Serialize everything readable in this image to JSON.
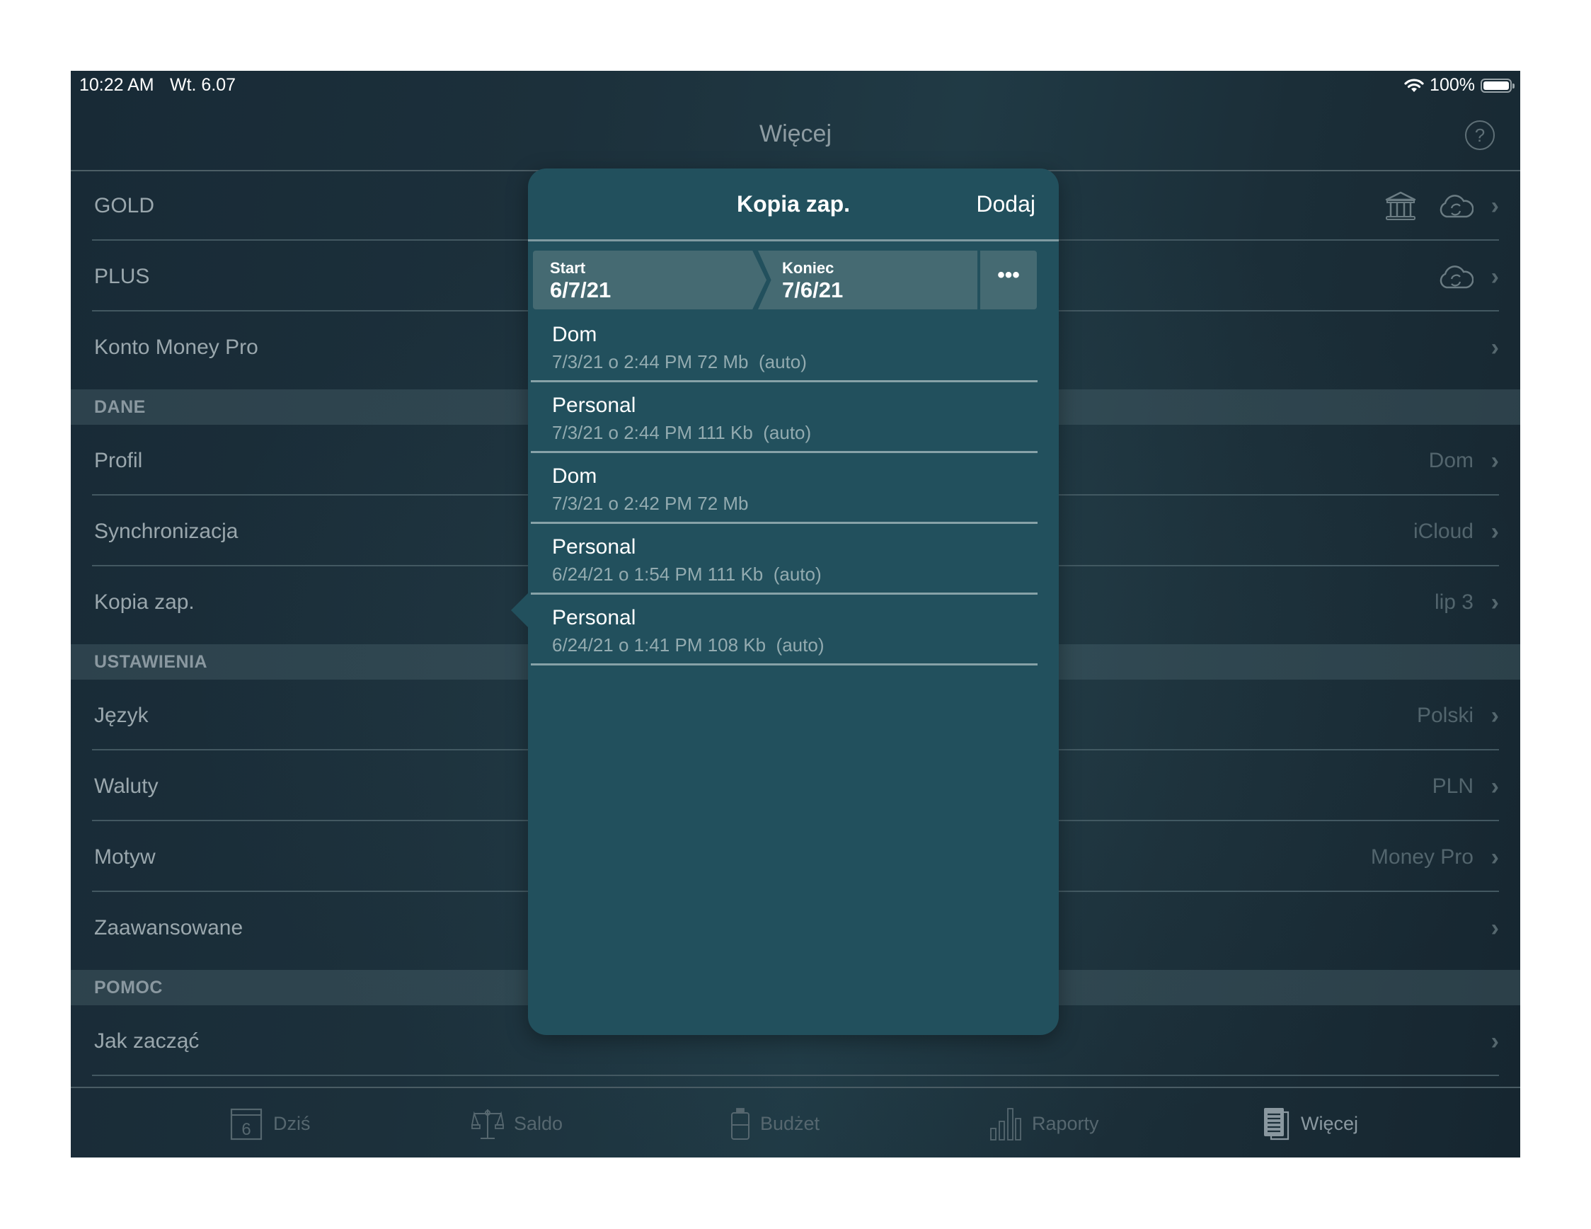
{
  "status_bar": {
    "time": "10:22 AM",
    "date": "Wt. 6.07",
    "battery": "100%",
    "battery_level": 1.0
  },
  "nav": {
    "title": "Więcej",
    "help_label": "?"
  },
  "list": {
    "rows_top": [
      {
        "label": "GOLD"
      },
      {
        "label": "PLUS"
      },
      {
        "label": "Konto Money Pro"
      }
    ],
    "sections": [
      {
        "title": "DANE",
        "rows": [
          {
            "label": "Profil",
            "value": "Dom"
          },
          {
            "label": "Synchronizacja",
            "value": "iCloud"
          },
          {
            "label": "Kopia zap.",
            "value": "lip 3"
          }
        ]
      },
      {
        "title": "USTAWIENIA",
        "rows": [
          {
            "label": "Język",
            "value": "Polski"
          },
          {
            "label": "Waluty",
            "value": "PLN"
          },
          {
            "label": "Motyw",
            "value": "Money Pro"
          },
          {
            "label": "Zaawansowane",
            "value": ""
          }
        ]
      },
      {
        "title": "POMOC",
        "rows": [
          {
            "label": "Jak zacząć",
            "value": ""
          }
        ]
      }
    ],
    "chevron": "›"
  },
  "popup": {
    "title": "Kopia zap.",
    "add_label": "Dodaj",
    "start_label": "Start",
    "start_value": "6/7/21",
    "end_label": "Koniec",
    "end_value": "7/6/21",
    "more_label": "•••",
    "items": [
      {
        "name": "Dom",
        "meta": "7/3/21 o 2:44 PM 72 Mb  (auto)"
      },
      {
        "name": "Personal",
        "meta": "7/3/21 o 2:44 PM 111 Kb  (auto)"
      },
      {
        "name": "Dom",
        "meta": "7/3/21 o 2:42 PM 72 Mb"
      },
      {
        "name": "Personal",
        "meta": "6/24/21 o 1:54 PM 111 Kb  (auto)"
      },
      {
        "name": "Personal",
        "meta": "6/24/21 o 1:41 PM 108 Kb  (auto)"
      }
    ]
  },
  "tabbar": {
    "tabs": [
      {
        "label": "Dziś",
        "icon": "calendar-icon",
        "badge": "6"
      },
      {
        "label": "Saldo",
        "icon": "scales-icon"
      },
      {
        "label": "Budżet",
        "icon": "budget-jar-icon"
      },
      {
        "label": "Raporty",
        "icon": "bar-chart-icon"
      },
      {
        "label": "Więcej",
        "icon": "document-icon",
        "active": true
      }
    ]
  }
}
